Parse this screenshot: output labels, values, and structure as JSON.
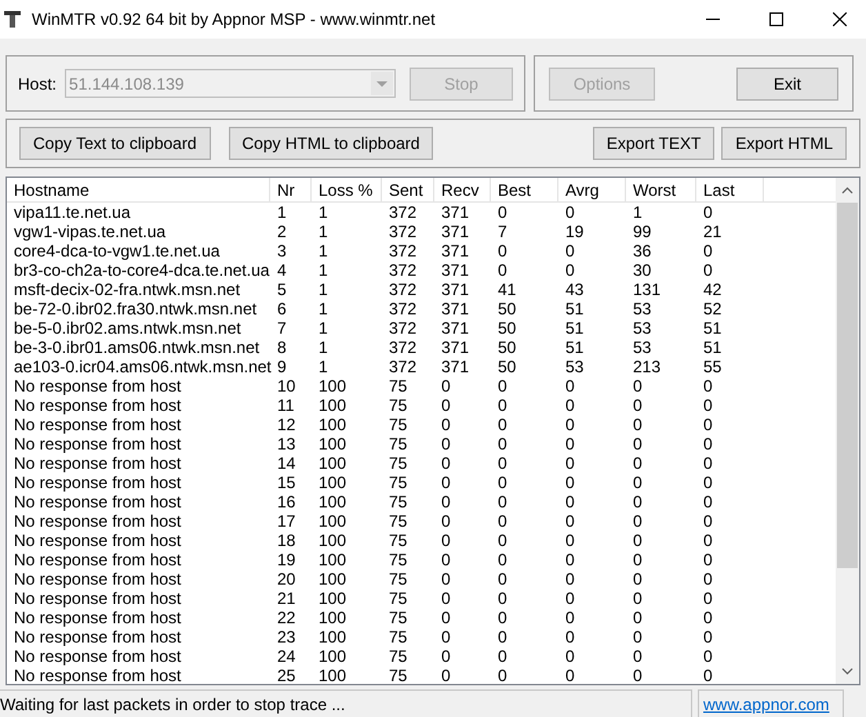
{
  "window": {
    "title": "WinMTR v0.92 64 bit by Appnor MSP - www.winmtr.net"
  },
  "host": {
    "label": "Host:",
    "value": "51.144.108.139",
    "disabled": true
  },
  "buttons_top": [
    {
      "label": "Stop",
      "disabled": true
    },
    {
      "label": "Options",
      "disabled": true
    },
    {
      "label": "Exit",
      "disabled": false
    }
  ],
  "buttons_export": [
    {
      "label": "Copy Text to clipboard"
    },
    {
      "label": "Copy HTML to clipboard"
    },
    {
      "label": "Export TEXT"
    },
    {
      "label": "Export HTML"
    }
  ],
  "table": {
    "columns": [
      "Hostname",
      "Nr",
      "Loss %",
      "Sent",
      "Recv",
      "Best",
      "Avrg",
      "Worst",
      "Last"
    ],
    "rows": [
      [
        "vipa11.te.net.ua",
        "1",
        "1",
        "372",
        "371",
        "0",
        "0",
        "1",
        "0"
      ],
      [
        "vgw1-vipas.te.net.ua",
        "2",
        "1",
        "372",
        "371",
        "7",
        "19",
        "99",
        "21"
      ],
      [
        "core4-dca-to-vgw1.te.net.ua",
        "3",
        "1",
        "372",
        "371",
        "0",
        "0",
        "36",
        "0"
      ],
      [
        "br3-co-ch2a-to-core4-dca.te.net.ua",
        "4",
        "1",
        "372",
        "371",
        "0",
        "0",
        "30",
        "0"
      ],
      [
        "msft-decix-02-fra.ntwk.msn.net",
        "5",
        "1",
        "372",
        "371",
        "41",
        "43",
        "131",
        "42"
      ],
      [
        "be-72-0.ibr02.fra30.ntwk.msn.net",
        "6",
        "1",
        "372",
        "371",
        "50",
        "51",
        "53",
        "52"
      ],
      [
        "be-5-0.ibr02.ams.ntwk.msn.net",
        "7",
        "1",
        "372",
        "371",
        "50",
        "51",
        "53",
        "51"
      ],
      [
        "be-3-0.ibr01.ams06.ntwk.msn.net",
        "8",
        "1",
        "372",
        "371",
        "50",
        "51",
        "53",
        "51"
      ],
      [
        "ae103-0.icr04.ams06.ntwk.msn.net",
        "9",
        "1",
        "372",
        "371",
        "50",
        "53",
        "213",
        "55"
      ],
      [
        "No response from host",
        "10",
        "100",
        "75",
        "0",
        "0",
        "0",
        "0",
        "0"
      ],
      [
        "No response from host",
        "11",
        "100",
        "75",
        "0",
        "0",
        "0",
        "0",
        "0"
      ],
      [
        "No response from host",
        "12",
        "100",
        "75",
        "0",
        "0",
        "0",
        "0",
        "0"
      ],
      [
        "No response from host",
        "13",
        "100",
        "75",
        "0",
        "0",
        "0",
        "0",
        "0"
      ],
      [
        "No response from host",
        "14",
        "100",
        "75",
        "0",
        "0",
        "0",
        "0",
        "0"
      ],
      [
        "No response from host",
        "15",
        "100",
        "75",
        "0",
        "0",
        "0",
        "0",
        "0"
      ],
      [
        "No response from host",
        "16",
        "100",
        "75",
        "0",
        "0",
        "0",
        "0",
        "0"
      ],
      [
        "No response from host",
        "17",
        "100",
        "75",
        "0",
        "0",
        "0",
        "0",
        "0"
      ],
      [
        "No response from host",
        "18",
        "100",
        "75",
        "0",
        "0",
        "0",
        "0",
        "0"
      ],
      [
        "No response from host",
        "19",
        "100",
        "75",
        "0",
        "0",
        "0",
        "0",
        "0"
      ],
      [
        "No response from host",
        "20",
        "100",
        "75",
        "0",
        "0",
        "0",
        "0",
        "0"
      ],
      [
        "No response from host",
        "21",
        "100",
        "75",
        "0",
        "0",
        "0",
        "0",
        "0"
      ],
      [
        "No response from host",
        "22",
        "100",
        "75",
        "0",
        "0",
        "0",
        "0",
        "0"
      ],
      [
        "No response from host",
        "23",
        "100",
        "75",
        "0",
        "0",
        "0",
        "0",
        "0"
      ],
      [
        "No response from host",
        "24",
        "100",
        "75",
        "0",
        "0",
        "0",
        "0",
        "0"
      ],
      [
        "No response from host",
        "25",
        "100",
        "75",
        "0",
        "0",
        "0",
        "0",
        "0"
      ]
    ]
  },
  "status_bar": {
    "message": "Waiting for last packets in order to stop trace ...",
    "link": "www.appnor.com"
  }
}
